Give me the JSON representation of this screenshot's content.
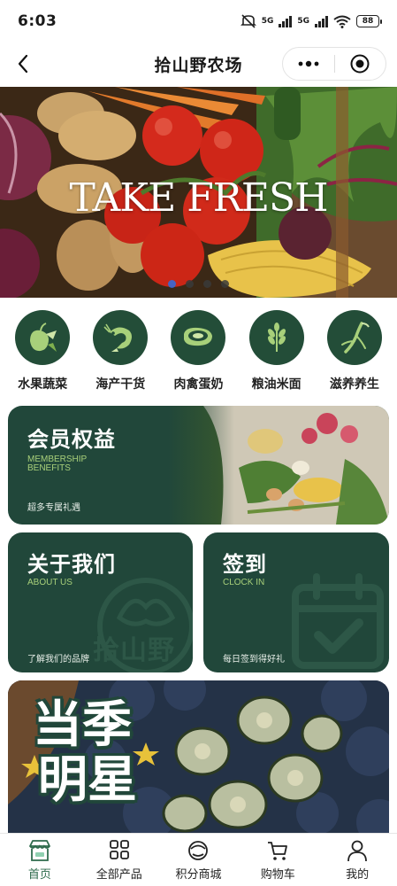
{
  "status_bar": {
    "time": "6:03",
    "network_1": "5G",
    "network_2": "5G",
    "battery": "88"
  },
  "nav": {
    "title": "拾山野农场",
    "icons": [
      "chevron-left-icon",
      "more-dots-icon",
      "close-target-icon"
    ]
  },
  "banner": {
    "text": "TAKE FRESH",
    "slide_count": 4,
    "active_slide": 1
  },
  "categories": [
    {
      "label": "水果蔬菜",
      "icon": "fruit-vegetable-icon"
    },
    {
      "label": "海产干货",
      "icon": "shrimp-icon"
    },
    {
      "label": "肉禽蛋奶",
      "icon": "meat-icon"
    },
    {
      "label": "粮油米面",
      "icon": "wheat-icon"
    },
    {
      "label": "滋养养生",
      "icon": "ginseng-icon"
    }
  ],
  "cards": {
    "member": {
      "title": "会员权益",
      "subtitle_line1": "MEMBERSHIP",
      "subtitle_line2": "BENEFITS",
      "desc": "超多专属礼遇"
    },
    "about": {
      "title": "关于我们",
      "subtitle": "ABOUT US",
      "desc": "了解我们的品牌",
      "watermark": "拾山野"
    },
    "checkin": {
      "title": "签到",
      "subtitle": "CLOCK IN",
      "desc": "每日签到得好礼"
    }
  },
  "season": {
    "line1": "当季",
    "line2": "明星"
  },
  "tab_bar": {
    "active": 0,
    "items": [
      {
        "label": "首页",
        "icon": "home-shop-icon"
      },
      {
        "label": "全部产品",
        "icon": "grid-icon"
      },
      {
        "label": "积分商城",
        "icon": "points-mall-icon"
      },
      {
        "label": "购物车",
        "icon": "cart-icon"
      },
      {
        "label": "我的",
        "icon": "user-icon"
      }
    ]
  },
  "colors": {
    "brand_green": "#21473a",
    "category_green": "#234d38",
    "accent_lime": "#a8d07a",
    "active_dot": "#2f6fe0"
  }
}
